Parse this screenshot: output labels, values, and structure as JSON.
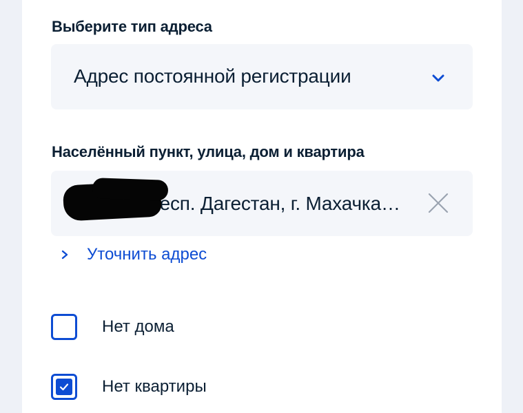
{
  "address_type": {
    "label": "Выберите тип адреса",
    "selected": "Адрес постоянной регистрации",
    "dropdown_icon": "chevron-down-icon"
  },
  "address": {
    "label": "Населённый пункт, улица, дом и квартира",
    "value": "367010, Респ. Дагестан, г. Махачка…",
    "clear_icon": "close-icon"
  },
  "refine_link": {
    "label": "Уточнить адрес",
    "icon": "chevron-right-icon"
  },
  "checkboxes": [
    {
      "label": "Нет дома",
      "checked": false
    },
    {
      "label": "Нет квартиры",
      "checked": true
    }
  ],
  "colors": {
    "accent": "#0d4cd3",
    "text": "#0b1f33",
    "field_bg": "#f4f6fa",
    "page_bg": "#eef1f7"
  }
}
